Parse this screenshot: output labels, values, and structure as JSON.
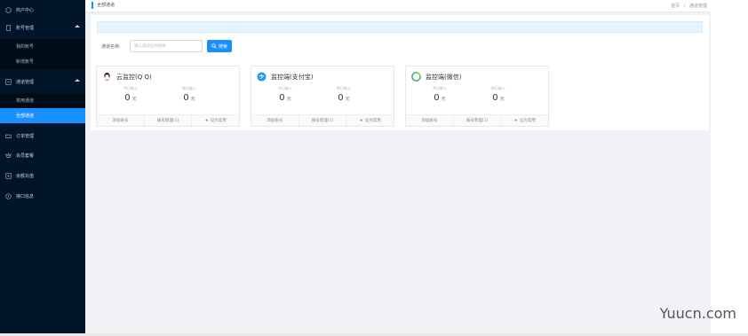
{
  "sidebar": {
    "items": [
      {
        "label": "商户中心",
        "icon": "circle-icon"
      },
      {
        "label": "账号管理",
        "icon": "account-icon"
      },
      {
        "label": "我的账号"
      },
      {
        "label": "新增账号"
      },
      {
        "label": "通道管理",
        "icon": "channel-icon"
      },
      {
        "label": "常用通道"
      },
      {
        "label": "全部通道"
      },
      {
        "label": "订单管理",
        "icon": "order-icon"
      },
      {
        "label": "会员套餐",
        "icon": "vip-icon"
      },
      {
        "label": "余额充值",
        "icon": "recharge-icon"
      },
      {
        "label": "接口信息",
        "icon": "api-icon"
      }
    ]
  },
  "header": {
    "title": "全部通道",
    "breadcrumb": [
      "首页",
      "/",
      "通道管理"
    ]
  },
  "search": {
    "label": "通道名称:",
    "placeholder": "输入通道名称搜索",
    "button": "搜索"
  },
  "cards": [
    {
      "name": "云监控(Q Q)",
      "icon": "qq-icon",
      "today_label": "今日收入",
      "today_value": "0",
      "today_unit": "元",
      "yesterday_label": "昨日收入",
      "yesterday_value": "0",
      "yesterday_unit": "元",
      "actions": [
        "添加账号",
        "账号管理(1)",
        "设为常用"
      ]
    },
    {
      "name": "监控端(支付宝)",
      "icon": "alipay-icon",
      "today_label": "今日收入",
      "today_value": "0",
      "today_unit": "元",
      "yesterday_label": "昨日收入",
      "yesterday_value": "0",
      "yesterday_unit": "元",
      "actions": [
        "添加账号",
        "账号管理(1)",
        "设为常用"
      ]
    },
    {
      "name": "监控端(微信)",
      "icon": "wechat-icon",
      "today_label": "今日收入",
      "today_value": "0",
      "today_unit": "元",
      "yesterday_label": "昨日收入",
      "yesterday_value": "0",
      "yesterday_unit": "元",
      "actions": [
        "添加账号",
        "账号管理(1)",
        "设为常用"
      ]
    }
  ],
  "watermark": "Yuucn.com",
  "colors": {
    "sidebar": "#001529",
    "accent": "#1890ff",
    "alert": "#e6f4ff"
  }
}
